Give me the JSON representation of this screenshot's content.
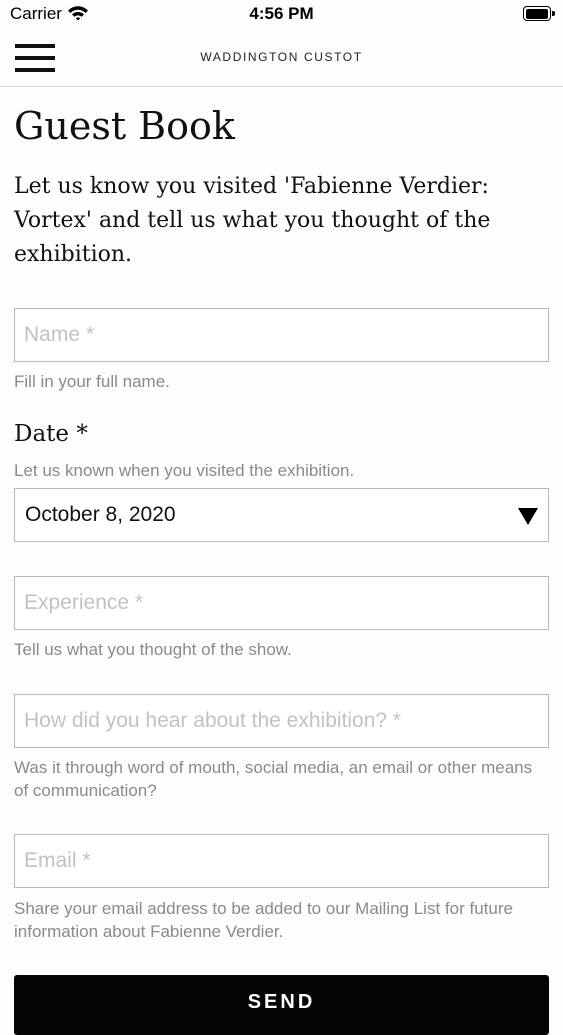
{
  "status_bar": {
    "carrier": "Carrier",
    "time": "4:56 PM",
    "icons": [
      "wifi-icon",
      "battery-icon"
    ]
  },
  "nav": {
    "brand": "WADDINGTON CUSTOT",
    "menu_icon": "hamburger-menu-icon"
  },
  "page": {
    "title": "Guest Book",
    "intro": "Let us know you visited 'Fabienne Verdier: Vortex' and tell us what you thought of the exhibition."
  },
  "form": {
    "name": {
      "placeholder": "Name *",
      "value": "",
      "help": "Fill in your full name."
    },
    "date": {
      "label": "Date *",
      "help": "Let us known when you visited the exhibition.",
      "selected": "October 8, 2020"
    },
    "experience": {
      "placeholder": "Experience *",
      "value": "",
      "help": "Tell us what you thought of the show."
    },
    "source": {
      "placeholder": "How did you hear about the exhibition? *",
      "value": "",
      "help": "Was it through word of mouth, social media, an email or other means of communication?"
    },
    "email": {
      "placeholder": "Email *",
      "value": "",
      "help": "Share your email address to be added to our Mailing List for future information about Fabienne Verdier."
    },
    "submit_label": "SEND"
  },
  "colors": {
    "text": "#111111",
    "help_text": "#8a8a8a",
    "field_border": "#b8b8b8",
    "button": "#050505"
  }
}
